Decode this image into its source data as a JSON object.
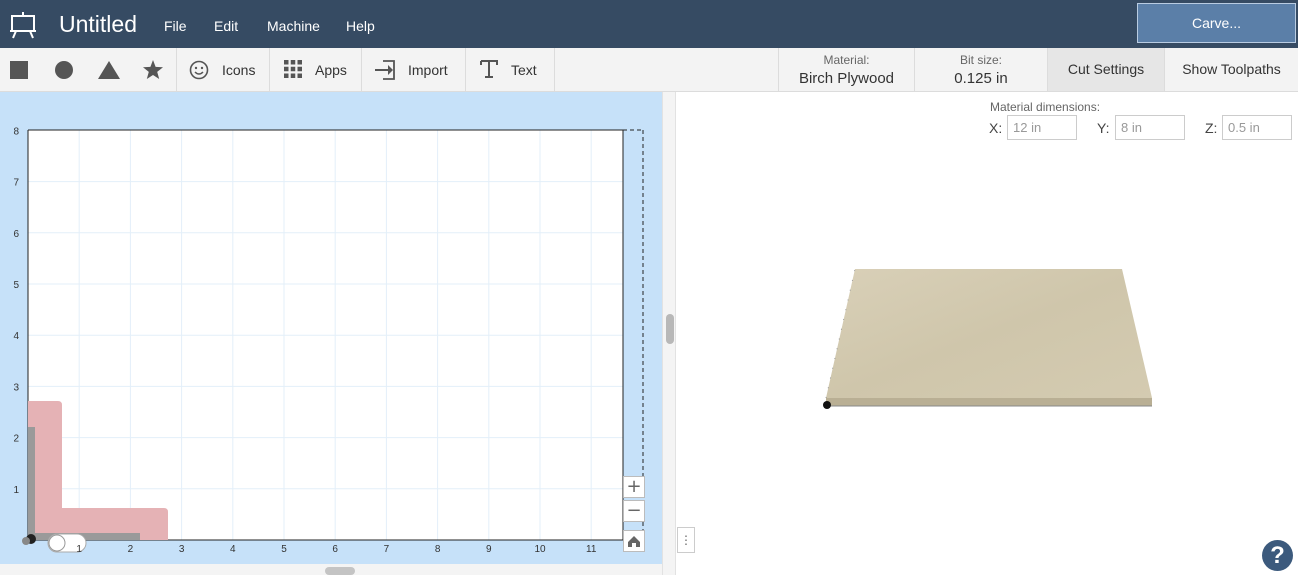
{
  "header": {
    "title": "Untitled",
    "menus": [
      "File",
      "Edit",
      "Machine",
      "Help"
    ],
    "carve_label": "Carve..."
  },
  "toolbar": {
    "shapes": [
      "square-icon",
      "circle-icon",
      "triangle-icon",
      "star-icon"
    ],
    "icons_label": "Icons",
    "apps_label": "Apps",
    "import_label": "Import",
    "text_label": "Text",
    "material_label": "Material:",
    "material_value": "Birch Plywood",
    "bit_label": "Bit size:",
    "bit_value": "0.125 in",
    "cut_settings_label": "Cut Settings",
    "show_toolpaths_label": "Show Toolpaths"
  },
  "canvas": {
    "y_ticks": [
      "8",
      "7",
      "6",
      "5",
      "4",
      "3",
      "2",
      "1"
    ],
    "x_ticks": [
      "1",
      "2",
      "3",
      "4",
      "5",
      "6",
      "7",
      "8",
      "9",
      "10",
      "11"
    ],
    "zoom_in": "+",
    "zoom_out": "−"
  },
  "material_dims": {
    "title": "Material dimensions:",
    "x_label": "X:",
    "x_value": "12 in",
    "y_label": "Y:",
    "y_value": "8 in",
    "z_label": "Z:",
    "z_value": "0.5 in"
  },
  "colors": {
    "header_bg": "#364b63",
    "carve_bg": "#5b7fa8",
    "canvas_bg": "#c6e1f9",
    "shape_fill": "#e5b2b5",
    "wood": "#d6cdb4"
  },
  "help_label": "?"
}
